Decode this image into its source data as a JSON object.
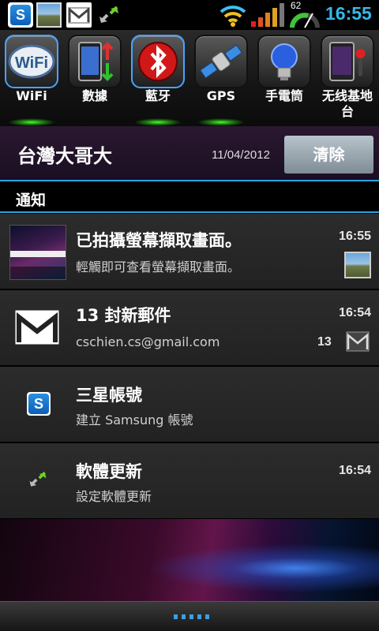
{
  "status_bar": {
    "battery_percent": "62",
    "time": "16:55",
    "icons": [
      "samsung-account-icon",
      "photo-icon",
      "gmail-icon",
      "software-update-icon",
      "wifi-icon",
      "signal-icon",
      "battery-icon"
    ]
  },
  "toggles": [
    {
      "label": "WiFi",
      "icon": "wifi-toggle-icon",
      "active": true
    },
    {
      "label": "數據",
      "icon": "mobile-data-icon",
      "active": false
    },
    {
      "label": "藍牙",
      "icon": "bluetooth-icon",
      "active": true
    },
    {
      "label": "GPS",
      "icon": "gps-satellite-icon",
      "active": true
    },
    {
      "label": "手電筒",
      "icon": "flashlight-bulb-icon",
      "active": false
    },
    {
      "label": "无线基地台",
      "icon": "hotspot-icon",
      "active": false
    }
  ],
  "carrier": {
    "name": "台灣大哥大",
    "date": "11/04/2012",
    "clear_label": "清除"
  },
  "section": {
    "title": "通知"
  },
  "notifications": [
    {
      "title": "已拍攝螢幕擷取畫面。",
      "text": "輕觸即可查看螢幕擷取畫面。",
      "time": "16:55",
      "icon": "screenshot-thumbnail"
    },
    {
      "title": "13 封新郵件",
      "text": "cschien.cs@gmail.com",
      "time": "16:54",
      "count": "13",
      "icon": "gmail-icon"
    },
    {
      "title": "三星帳號",
      "text": "建立 Samsung 帳號",
      "time": "",
      "icon": "samsung-account-icon"
    },
    {
      "title": "軟體更新",
      "text": "設定軟體更新",
      "time": "16:54",
      "icon": "software-update-icon"
    }
  ],
  "colors": {
    "accent": "#2aa3e0",
    "clock": "#39b6e8",
    "indicator_on": "#4cff2a"
  }
}
